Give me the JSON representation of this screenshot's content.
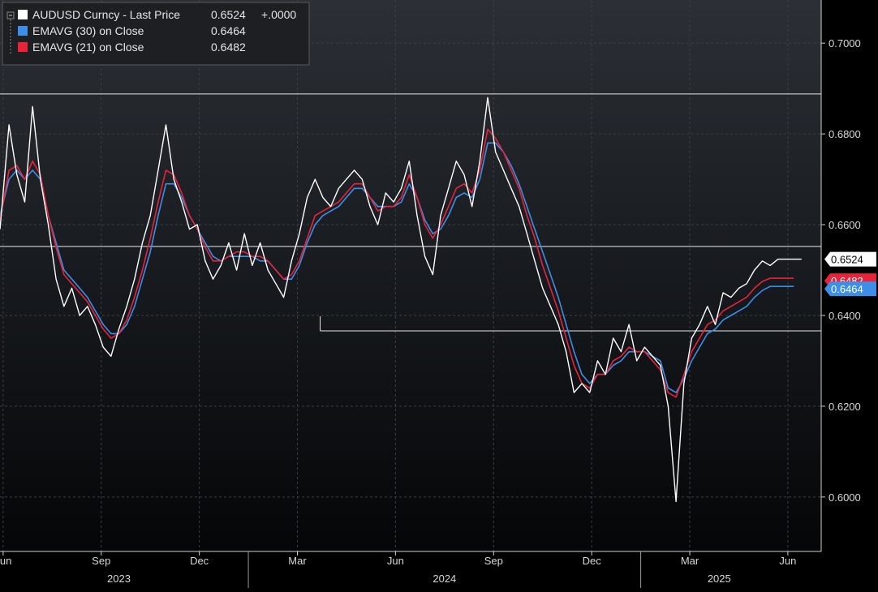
{
  "legend": {
    "entries": [
      {
        "name": "AUDUSD Curncy  - Last Price",
        "value": "0.6524",
        "extra": "+.0000",
        "color": "#ffffff"
      },
      {
        "name": "EMAVG (30)  on Close",
        "value": "0.6464",
        "extra": "",
        "color": "#3d8ee6"
      },
      {
        "name": "EMAVG (21)  on Close",
        "value": "0.6482",
        "extra": "",
        "color": "#e8233a"
      }
    ]
  },
  "price_tags": [
    {
      "label": "0.6524",
      "value": 0.6524,
      "bg": "#ffffff",
      "fg": "#000000"
    },
    {
      "label": "0.6482",
      "value": 0.6482,
      "bg": "#e8233a",
      "fg": "#ffffff"
    },
    {
      "label": "0.6464",
      "value": 0.6464,
      "bg": "#3d8ee6",
      "fg": "#ffffff"
    }
  ],
  "chart_data": {
    "type": "line",
    "ylim": [
      0.588,
      0.7095
    ],
    "yticks": [
      {
        "label": "0.7000",
        "value": 0.7
      },
      {
        "label": "0.6800",
        "value": 0.68
      },
      {
        "label": "0.6600",
        "value": 0.66
      },
      {
        "label": "0.6400",
        "value": 0.64
      },
      {
        "label": "0.6200",
        "value": 0.62
      },
      {
        "label": "0.6000",
        "value": 0.6
      }
    ],
    "xlim": [
      2023.367,
      2025.46
    ],
    "xticks": [
      {
        "label": "Jun",
        "value": 2023.375
      },
      {
        "label": "Sep",
        "value": 2023.625
      },
      {
        "label": "Dec",
        "value": 2023.875
      },
      {
        "label": "Mar",
        "value": 2024.125
      },
      {
        "label": "Jun",
        "value": 2024.375
      },
      {
        "label": "Sep",
        "value": 2024.625
      },
      {
        "label": "Dec",
        "value": 2024.875
      },
      {
        "label": "Mar",
        "value": 2025.125
      },
      {
        "label": "Jun",
        "value": 2025.375
      }
    ],
    "years": [
      {
        "label": "2023",
        "value": 2023.67
      },
      {
        "label": "2024",
        "value": 2024.5
      },
      {
        "label": "2025",
        "value": 2025.2
      }
    ],
    "year_boundaries": [
      2024.0,
      2025.0
    ],
    "hlines": [
      {
        "value": 0.6888,
        "from": 2023.367,
        "to": 2025.46
      },
      {
        "value": 0.6552,
        "from": 2023.367,
        "to": 2025.46
      },
      {
        "value": 0.6366,
        "from": 2024.183,
        "to": 2025.46
      }
    ],
    "series": [
      {
        "name": "AUDUSD Curncy  - Last Price",
        "color": "#ffffff",
        "x": [
          2023.367,
          2023.39,
          2023.41,
          2023.43,
          2023.45,
          2023.47,
          2023.49,
          2023.51,
          2023.53,
          2023.55,
          2023.57,
          2023.59,
          2023.61,
          2023.63,
          2023.65,
          2023.67,
          2023.69,
          2023.71,
          2023.73,
          2023.75,
          2023.77,
          2023.79,
          2023.81,
          2023.83,
          2023.85,
          2023.87,
          2023.89,
          2023.91,
          2023.93,
          2023.95,
          2023.97,
          2023.99,
          2024.01,
          2024.03,
          2024.05,
          2024.07,
          2024.09,
          2024.11,
          2024.13,
          2024.15,
          2024.17,
          2024.19,
          2024.21,
          2024.23,
          2024.25,
          2024.27,
          2024.29,
          2024.31,
          2024.33,
          2024.35,
          2024.37,
          2024.39,
          2024.41,
          2024.43,
          2024.45,
          2024.47,
          2024.49,
          2024.51,
          2024.53,
          2024.55,
          2024.57,
          2024.59,
          2024.61,
          2024.63,
          2024.65,
          2024.67,
          2024.69,
          2024.71,
          2024.73,
          2024.75,
          2024.77,
          2024.79,
          2024.81,
          2024.83,
          2024.85,
          2024.87,
          2024.89,
          2024.91,
          2024.93,
          2024.95,
          2024.97,
          2024.99,
          2025.01,
          2025.03,
          2025.05,
          2025.07,
          2025.09,
          2025.11,
          2025.13,
          2025.15,
          2025.17,
          2025.19,
          2025.21,
          2025.23,
          2025.25,
          2025.27,
          2025.29,
          2025.31,
          2025.33,
          2025.35,
          2025.37,
          2025.39,
          2025.41
        ],
        "y": [
          0.659,
          0.682,
          0.671,
          0.665,
          0.686,
          0.67,
          0.66,
          0.648,
          0.642,
          0.646,
          0.64,
          0.642,
          0.638,
          0.633,
          0.631,
          0.637,
          0.642,
          0.648,
          0.656,
          0.662,
          0.672,
          0.682,
          0.67,
          0.665,
          0.659,
          0.66,
          0.652,
          0.648,
          0.651,
          0.656,
          0.65,
          0.658,
          0.651,
          0.656,
          0.65,
          0.647,
          0.644,
          0.652,
          0.658,
          0.666,
          0.67,
          0.666,
          0.664,
          0.668,
          0.67,
          0.672,
          0.67,
          0.664,
          0.66,
          0.667,
          0.665,
          0.668,
          0.674,
          0.662,
          0.653,
          0.649,
          0.662,
          0.668,
          0.674,
          0.671,
          0.664,
          0.674,
          0.688,
          0.676,
          0.672,
          0.668,
          0.664,
          0.658,
          0.652,
          0.646,
          0.642,
          0.638,
          0.632,
          0.623,
          0.625,
          0.623,
          0.63,
          0.627,
          0.635,
          0.632,
          0.638,
          0.63,
          0.633,
          0.631,
          0.629,
          0.62,
          0.599,
          0.625,
          0.635,
          0.638,
          0.642,
          0.638,
          0.645,
          0.644,
          0.646,
          0.647,
          0.65,
          0.652,
          0.651,
          0.6524,
          0.6524,
          0.6524,
          0.6524
        ]
      },
      {
        "name": "EMAVG (30)  on Close",
        "color": "#3d8ee6",
        "x": [
          2023.367,
          2023.39,
          2023.41,
          2023.43,
          2023.45,
          2023.47,
          2023.49,
          2023.51,
          2023.53,
          2023.55,
          2023.57,
          2023.59,
          2023.61,
          2023.63,
          2023.65,
          2023.67,
          2023.69,
          2023.71,
          2023.73,
          2023.75,
          2023.77,
          2023.79,
          2023.81,
          2023.83,
          2023.85,
          2023.87,
          2023.89,
          2023.91,
          2023.93,
          2023.95,
          2023.97,
          2023.99,
          2024.01,
          2024.03,
          2024.05,
          2024.07,
          2024.09,
          2024.11,
          2024.13,
          2024.15,
          2024.17,
          2024.19,
          2024.21,
          2024.23,
          2024.25,
          2024.27,
          2024.29,
          2024.31,
          2024.33,
          2024.35,
          2024.37,
          2024.39,
          2024.41,
          2024.43,
          2024.45,
          2024.47,
          2024.49,
          2024.51,
          2024.53,
          2024.55,
          2024.57,
          2024.59,
          2024.61,
          2024.63,
          2024.65,
          2024.67,
          2024.69,
          2024.71,
          2024.73,
          2024.75,
          2024.77,
          2024.79,
          2024.81,
          2024.83,
          2024.85,
          2024.87,
          2024.89,
          2024.91,
          2024.93,
          2024.95,
          2024.97,
          2024.99,
          2025.01,
          2025.03,
          2025.05,
          2025.07,
          2025.09,
          2025.11,
          2025.13,
          2025.15,
          2025.17,
          2025.19,
          2025.21,
          2025.23,
          2025.25,
          2025.27,
          2025.29,
          2025.31,
          2025.33,
          2025.35,
          2025.37,
          2025.39
        ],
        "y": [
          0.662,
          0.67,
          0.672,
          0.67,
          0.672,
          0.67,
          0.662,
          0.656,
          0.65,
          0.648,
          0.646,
          0.644,
          0.641,
          0.638,
          0.636,
          0.636,
          0.638,
          0.642,
          0.648,
          0.654,
          0.662,
          0.669,
          0.669,
          0.666,
          0.662,
          0.659,
          0.656,
          0.653,
          0.652,
          0.653,
          0.653,
          0.653,
          0.653,
          0.652,
          0.652,
          0.65,
          0.648,
          0.648,
          0.651,
          0.656,
          0.66,
          0.662,
          0.663,
          0.664,
          0.666,
          0.668,
          0.668,
          0.666,
          0.664,
          0.664,
          0.664,
          0.665,
          0.669,
          0.666,
          0.661,
          0.658,
          0.659,
          0.662,
          0.666,
          0.667,
          0.666,
          0.67,
          0.678,
          0.678,
          0.676,
          0.673,
          0.669,
          0.664,
          0.659,
          0.654,
          0.649,
          0.644,
          0.638,
          0.632,
          0.627,
          0.625,
          0.627,
          0.627,
          0.629,
          0.63,
          0.632,
          0.632,
          0.632,
          0.631,
          0.63,
          0.624,
          0.623,
          0.626,
          0.63,
          0.633,
          0.636,
          0.637,
          0.639,
          0.64,
          0.641,
          0.642,
          0.644,
          0.6455,
          0.6464,
          0.6464,
          0.6464,
          0.6464
        ]
      },
      {
        "name": "EMAVG (21)  on Close",
        "color": "#e8233a",
        "x": [
          2023.367,
          2023.39,
          2023.41,
          2023.43,
          2023.45,
          2023.47,
          2023.49,
          2023.51,
          2023.53,
          2023.55,
          2023.57,
          2023.59,
          2023.61,
          2023.63,
          2023.65,
          2023.67,
          2023.69,
          2023.71,
          2023.73,
          2023.75,
          2023.77,
          2023.79,
          2023.81,
          2023.83,
          2023.85,
          2023.87,
          2023.89,
          2023.91,
          2023.93,
          2023.95,
          2023.97,
          2023.99,
          2024.01,
          2024.03,
          2024.05,
          2024.07,
          2024.09,
          2024.11,
          2024.13,
          2024.15,
          2024.17,
          2024.19,
          2024.21,
          2024.23,
          2024.25,
          2024.27,
          2024.29,
          2024.31,
          2024.33,
          2024.35,
          2024.37,
          2024.39,
          2024.41,
          2024.43,
          2024.45,
          2024.47,
          2024.49,
          2024.51,
          2024.53,
          2024.55,
          2024.57,
          2024.59,
          2024.61,
          2024.63,
          2024.65,
          2024.67,
          2024.69,
          2024.71,
          2024.73,
          2024.75,
          2024.77,
          2024.79,
          2024.81,
          2024.83,
          2024.85,
          2024.87,
          2024.89,
          2024.91,
          2024.93,
          2024.95,
          2024.97,
          2024.99,
          2025.01,
          2025.03,
          2025.05,
          2025.07,
          2025.09,
          2025.11,
          2025.13,
          2025.15,
          2025.17,
          2025.19,
          2025.21,
          2025.23,
          2025.25,
          2025.27,
          2025.29,
          2025.31,
          2025.33,
          2025.35,
          2025.37,
          2025.39
        ],
        "y": [
          0.661,
          0.672,
          0.673,
          0.67,
          0.674,
          0.671,
          0.662,
          0.655,
          0.649,
          0.647,
          0.645,
          0.643,
          0.64,
          0.637,
          0.635,
          0.636,
          0.639,
          0.644,
          0.65,
          0.657,
          0.665,
          0.672,
          0.671,
          0.667,
          0.662,
          0.659,
          0.655,
          0.652,
          0.652,
          0.653,
          0.654,
          0.654,
          0.653,
          0.653,
          0.652,
          0.65,
          0.648,
          0.649,
          0.652,
          0.657,
          0.662,
          0.663,
          0.664,
          0.665,
          0.667,
          0.669,
          0.669,
          0.666,
          0.663,
          0.664,
          0.664,
          0.666,
          0.671,
          0.666,
          0.66,
          0.657,
          0.66,
          0.664,
          0.668,
          0.669,
          0.667,
          0.672,
          0.681,
          0.679,
          0.676,
          0.672,
          0.668,
          0.662,
          0.657,
          0.651,
          0.646,
          0.641,
          0.635,
          0.629,
          0.625,
          0.624,
          0.627,
          0.627,
          0.63,
          0.631,
          0.633,
          0.632,
          0.632,
          0.63,
          0.628,
          0.623,
          0.622,
          0.627,
          0.632,
          0.635,
          0.638,
          0.639,
          0.641,
          0.642,
          0.643,
          0.644,
          0.646,
          0.6475,
          0.6482,
          0.6482,
          0.6482,
          0.6482
        ]
      }
    ]
  }
}
